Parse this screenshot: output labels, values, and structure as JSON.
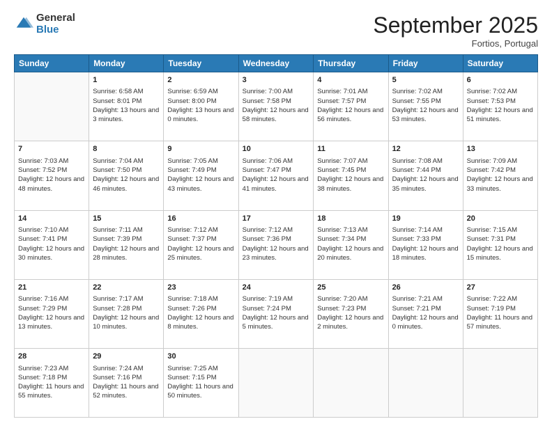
{
  "header": {
    "logo_general": "General",
    "logo_blue": "Blue",
    "month_title": "September 2025",
    "location": "Fortios, Portugal"
  },
  "days_of_week": [
    "Sunday",
    "Monday",
    "Tuesday",
    "Wednesday",
    "Thursday",
    "Friday",
    "Saturday"
  ],
  "weeks": [
    [
      {
        "day": "",
        "sunrise": "",
        "sunset": "",
        "daylight": ""
      },
      {
        "day": "1",
        "sunrise": "Sunrise: 6:58 AM",
        "sunset": "Sunset: 8:01 PM",
        "daylight": "Daylight: 13 hours and 3 minutes."
      },
      {
        "day": "2",
        "sunrise": "Sunrise: 6:59 AM",
        "sunset": "Sunset: 8:00 PM",
        "daylight": "Daylight: 13 hours and 0 minutes."
      },
      {
        "day": "3",
        "sunrise": "Sunrise: 7:00 AM",
        "sunset": "Sunset: 7:58 PM",
        "daylight": "Daylight: 12 hours and 58 minutes."
      },
      {
        "day": "4",
        "sunrise": "Sunrise: 7:01 AM",
        "sunset": "Sunset: 7:57 PM",
        "daylight": "Daylight: 12 hours and 56 minutes."
      },
      {
        "day": "5",
        "sunrise": "Sunrise: 7:02 AM",
        "sunset": "Sunset: 7:55 PM",
        "daylight": "Daylight: 12 hours and 53 minutes."
      },
      {
        "day": "6",
        "sunrise": "Sunrise: 7:02 AM",
        "sunset": "Sunset: 7:53 PM",
        "daylight": "Daylight: 12 hours and 51 minutes."
      }
    ],
    [
      {
        "day": "7",
        "sunrise": "Sunrise: 7:03 AM",
        "sunset": "Sunset: 7:52 PM",
        "daylight": "Daylight: 12 hours and 48 minutes."
      },
      {
        "day": "8",
        "sunrise": "Sunrise: 7:04 AM",
        "sunset": "Sunset: 7:50 PM",
        "daylight": "Daylight: 12 hours and 46 minutes."
      },
      {
        "day": "9",
        "sunrise": "Sunrise: 7:05 AM",
        "sunset": "Sunset: 7:49 PM",
        "daylight": "Daylight: 12 hours and 43 minutes."
      },
      {
        "day": "10",
        "sunrise": "Sunrise: 7:06 AM",
        "sunset": "Sunset: 7:47 PM",
        "daylight": "Daylight: 12 hours and 41 minutes."
      },
      {
        "day": "11",
        "sunrise": "Sunrise: 7:07 AM",
        "sunset": "Sunset: 7:45 PM",
        "daylight": "Daylight: 12 hours and 38 minutes."
      },
      {
        "day": "12",
        "sunrise": "Sunrise: 7:08 AM",
        "sunset": "Sunset: 7:44 PM",
        "daylight": "Daylight: 12 hours and 35 minutes."
      },
      {
        "day": "13",
        "sunrise": "Sunrise: 7:09 AM",
        "sunset": "Sunset: 7:42 PM",
        "daylight": "Daylight: 12 hours and 33 minutes."
      }
    ],
    [
      {
        "day": "14",
        "sunrise": "Sunrise: 7:10 AM",
        "sunset": "Sunset: 7:41 PM",
        "daylight": "Daylight: 12 hours and 30 minutes."
      },
      {
        "day": "15",
        "sunrise": "Sunrise: 7:11 AM",
        "sunset": "Sunset: 7:39 PM",
        "daylight": "Daylight: 12 hours and 28 minutes."
      },
      {
        "day": "16",
        "sunrise": "Sunrise: 7:12 AM",
        "sunset": "Sunset: 7:37 PM",
        "daylight": "Daylight: 12 hours and 25 minutes."
      },
      {
        "day": "17",
        "sunrise": "Sunrise: 7:12 AM",
        "sunset": "Sunset: 7:36 PM",
        "daylight": "Daylight: 12 hours and 23 minutes."
      },
      {
        "day": "18",
        "sunrise": "Sunrise: 7:13 AM",
        "sunset": "Sunset: 7:34 PM",
        "daylight": "Daylight: 12 hours and 20 minutes."
      },
      {
        "day": "19",
        "sunrise": "Sunrise: 7:14 AM",
        "sunset": "Sunset: 7:33 PM",
        "daylight": "Daylight: 12 hours and 18 minutes."
      },
      {
        "day": "20",
        "sunrise": "Sunrise: 7:15 AM",
        "sunset": "Sunset: 7:31 PM",
        "daylight": "Daylight: 12 hours and 15 minutes."
      }
    ],
    [
      {
        "day": "21",
        "sunrise": "Sunrise: 7:16 AM",
        "sunset": "Sunset: 7:29 PM",
        "daylight": "Daylight: 12 hours and 13 minutes."
      },
      {
        "day": "22",
        "sunrise": "Sunrise: 7:17 AM",
        "sunset": "Sunset: 7:28 PM",
        "daylight": "Daylight: 12 hours and 10 minutes."
      },
      {
        "day": "23",
        "sunrise": "Sunrise: 7:18 AM",
        "sunset": "Sunset: 7:26 PM",
        "daylight": "Daylight: 12 hours and 8 minutes."
      },
      {
        "day": "24",
        "sunrise": "Sunrise: 7:19 AM",
        "sunset": "Sunset: 7:24 PM",
        "daylight": "Daylight: 12 hours and 5 minutes."
      },
      {
        "day": "25",
        "sunrise": "Sunrise: 7:20 AM",
        "sunset": "Sunset: 7:23 PM",
        "daylight": "Daylight: 12 hours and 2 minutes."
      },
      {
        "day": "26",
        "sunrise": "Sunrise: 7:21 AM",
        "sunset": "Sunset: 7:21 PM",
        "daylight": "Daylight: 12 hours and 0 minutes."
      },
      {
        "day": "27",
        "sunrise": "Sunrise: 7:22 AM",
        "sunset": "Sunset: 7:19 PM",
        "daylight": "Daylight: 11 hours and 57 minutes."
      }
    ],
    [
      {
        "day": "28",
        "sunrise": "Sunrise: 7:23 AM",
        "sunset": "Sunset: 7:18 PM",
        "daylight": "Daylight: 11 hours and 55 minutes."
      },
      {
        "day": "29",
        "sunrise": "Sunrise: 7:24 AM",
        "sunset": "Sunset: 7:16 PM",
        "daylight": "Daylight: 11 hours and 52 minutes."
      },
      {
        "day": "30",
        "sunrise": "Sunrise: 7:25 AM",
        "sunset": "Sunset: 7:15 PM",
        "daylight": "Daylight: 11 hours and 50 minutes."
      },
      {
        "day": "",
        "sunrise": "",
        "sunset": "",
        "daylight": ""
      },
      {
        "day": "",
        "sunrise": "",
        "sunset": "",
        "daylight": ""
      },
      {
        "day": "",
        "sunrise": "",
        "sunset": "",
        "daylight": ""
      },
      {
        "day": "",
        "sunrise": "",
        "sunset": "",
        "daylight": ""
      }
    ]
  ]
}
